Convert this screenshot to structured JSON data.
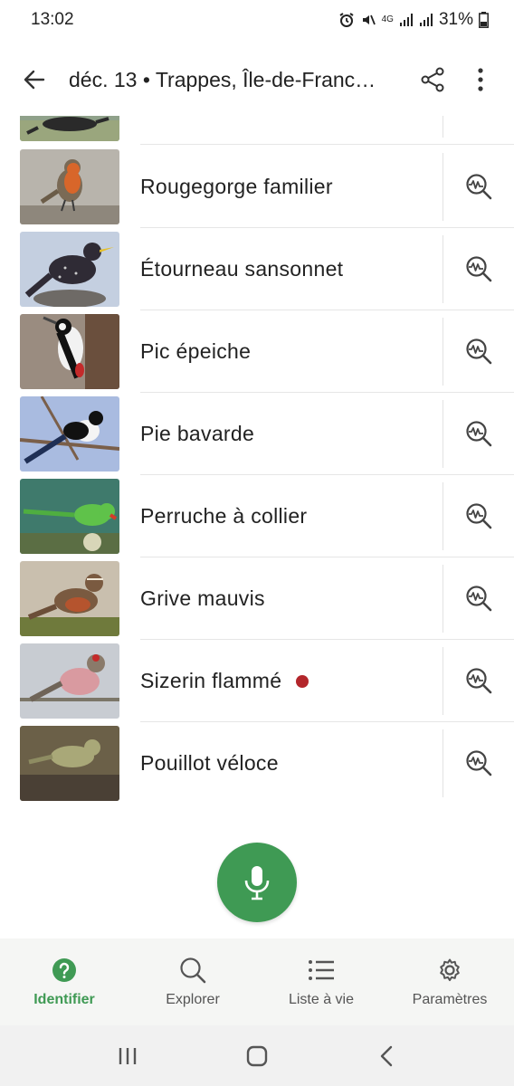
{
  "status_bar": {
    "time": "13:02",
    "network": "4G",
    "battery": "31%"
  },
  "app_bar": {
    "title": "déc. 13 • Trappes, Île-de-Franc…"
  },
  "birds": [
    {
      "name": "Rougegorge familier",
      "new": false
    },
    {
      "name": "Étourneau sansonnet",
      "new": false
    },
    {
      "name": "Pic épeiche",
      "new": false
    },
    {
      "name": "Pie bavarde",
      "new": false
    },
    {
      "name": "Perruche à collier",
      "new": false
    },
    {
      "name": "Grive mauvis",
      "new": false
    },
    {
      "name": "Sizerin flammé",
      "new": true
    },
    {
      "name": "Pouillot véloce",
      "new": false
    }
  ],
  "nav": {
    "identify": "Identifier",
    "explore": "Explorer",
    "life_list": "Liste à vie",
    "settings": "Paramètres"
  },
  "colors": {
    "accent": "#3f9a54",
    "new_dot": "#b3262b"
  },
  "icons": {
    "back": "arrow-left-icon",
    "share": "share-icon",
    "more": "more-vert-icon",
    "explore": "spectrogram-search-icon",
    "mic": "microphone-icon"
  }
}
